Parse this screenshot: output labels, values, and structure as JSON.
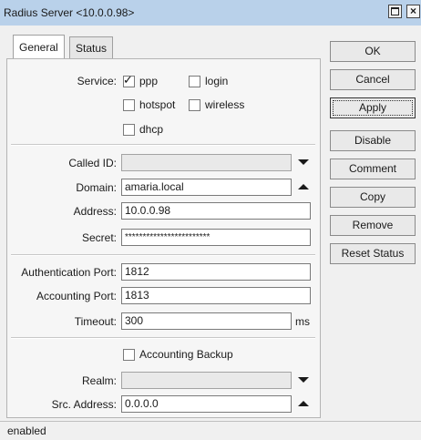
{
  "window": {
    "title": "Radius Server <10.0.0.98>"
  },
  "tabs": [
    {
      "label": "General"
    },
    {
      "label": "Status"
    }
  ],
  "service": {
    "label": "Service:",
    "options": [
      {
        "label": "ppp",
        "checked": true
      },
      {
        "label": "login",
        "checked": false
      },
      {
        "label": "hotspot",
        "checked": false
      },
      {
        "label": "wireless",
        "checked": false
      },
      {
        "label": "dhcp",
        "checked": false
      }
    ]
  },
  "fields": {
    "called_id": {
      "label": "Called ID:",
      "value": ""
    },
    "domain": {
      "label": "Domain:",
      "value": "amaria.local"
    },
    "address": {
      "label": "Address:",
      "value": "10.0.0.98"
    },
    "secret": {
      "label": "Secret:",
      "value": "************************"
    },
    "auth_port": {
      "label": "Authentication Port:",
      "value": "1812"
    },
    "acct_port": {
      "label": "Accounting Port:",
      "value": "1813"
    },
    "timeout": {
      "label": "Timeout:",
      "value": "300",
      "unit": "ms"
    },
    "accounting_backup": {
      "label": "Accounting Backup",
      "checked": false
    },
    "realm": {
      "label": "Realm:",
      "value": ""
    },
    "src_address": {
      "label": "Src. Address:",
      "value": "0.0.0.0"
    }
  },
  "buttons": [
    "OK",
    "Cancel",
    "Apply",
    "Disable",
    "Comment",
    "Copy",
    "Remove",
    "Reset Status"
  ],
  "status_bar": {
    "text": "enabled"
  }
}
